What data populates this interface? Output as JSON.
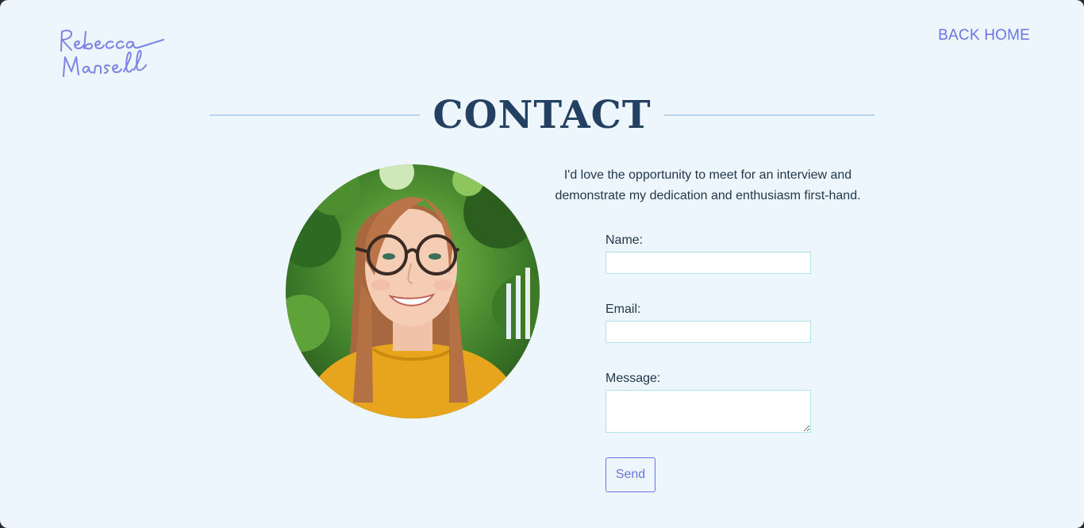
{
  "header": {
    "logo_text": "Rebecca Mansell",
    "back_home": "BACK HOME"
  },
  "page": {
    "title": "CONTACT",
    "intro_line1": "I'd love the opportunity to meet for an interview and",
    "intro_line2": "demonstrate my dedication and enthusiasm first-hand."
  },
  "form": {
    "name_label": "Name:",
    "email_label": "Email:",
    "message_label": "Message:",
    "name_value": "",
    "email_value": "",
    "message_value": "",
    "send_label": "Send"
  },
  "colors": {
    "background": "#eef6fd",
    "accent": "#6b74e6",
    "heading": "#233f62",
    "rule": "#b8d3ec"
  }
}
